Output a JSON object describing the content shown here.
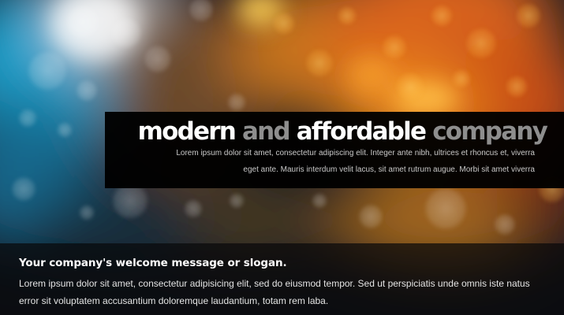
{
  "banner": {
    "headline": {
      "word1": "modern",
      "word2": "and",
      "word3": "affordable",
      "word4": "company"
    },
    "text": "Lorem ipsum dolor sit amet, consectetur adipiscing elit. Integer ante nibh, ultrices et rhoncus et, viverra eget ante. Mauris interdum velit lacus, sit amet rutrum augue. Morbi sit amet viverra"
  },
  "welcome": {
    "title": "Your company's welcome message or slogan.",
    "body": "Lorem ipsum dolor sit amet, consectetur adipisicing elit, sed do eiusmod tempor. Sed ut perspiciatis unde omnis iste natus error sit voluptatem accusantium doloremque laudantium, totam rem laba."
  },
  "colors": {
    "headline_primary": "#ffffff",
    "headline_secondary": "#8e8e8e",
    "banner_bg": "#000000",
    "bokeh_blue": "#1a9ec9",
    "bokeh_orange": "#ee8a18"
  }
}
